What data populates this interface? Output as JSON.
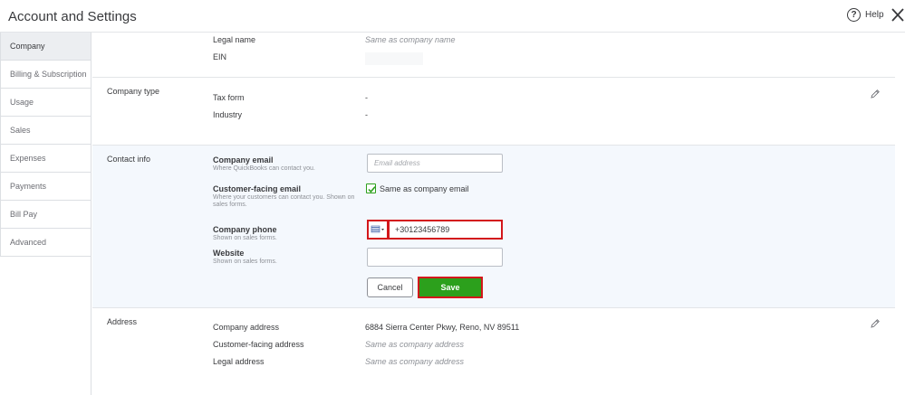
{
  "header": {
    "title": "Account and Settings",
    "help_label": "Help",
    "help_icon_glyph": "?"
  },
  "sidebar": {
    "items": [
      {
        "label": "Company",
        "active": true
      },
      {
        "label": "Billing & Subscription",
        "active": false
      },
      {
        "label": "Usage",
        "active": false
      },
      {
        "label": "Sales",
        "active": false
      },
      {
        "label": "Expenses",
        "active": false
      },
      {
        "label": "Payments",
        "active": false
      },
      {
        "label": "Bill Pay",
        "active": false
      },
      {
        "label": "Advanced",
        "active": false
      }
    ]
  },
  "company_name_section": {
    "legal_name_label": "Legal name",
    "legal_name_value": "Same as company name",
    "ein_label": "EIN"
  },
  "company_type_section": {
    "title": "Company type",
    "tax_form_label": "Tax form",
    "tax_form_value": "-",
    "industry_label": "Industry",
    "industry_value": "-"
  },
  "contact_info_section": {
    "title": "Contact info",
    "company_email_label": "Company email",
    "company_email_sub": "Where QuickBooks can contact you.",
    "company_email_placeholder": "Email address",
    "customer_email_label": "Customer-facing email",
    "customer_email_sub": "Where your customers can contact you. Shown on sales forms.",
    "same_as_company_email_label": "Same as company email",
    "same_as_company_email_checked": true,
    "company_phone_label": "Company phone",
    "company_phone_sub": "Shown on sales forms.",
    "company_phone_value": "+30123456789",
    "website_label": "Website",
    "website_sub": "Shown on sales forms.",
    "website_value": "",
    "cancel_label": "Cancel",
    "save_label": "Save"
  },
  "address_section": {
    "title": "Address",
    "company_address_label": "Company address",
    "company_address_value": "6884 Sierra Center Pkwy, Reno, NV 89511",
    "customer_address_label": "Customer-facing address",
    "customer_address_value": "Same as company address",
    "legal_address_label": "Legal address",
    "legal_address_value": "Same as company address"
  },
  "colors": {
    "accent_green": "#2ca01c",
    "highlight_red": "#d3171b",
    "contact_bg": "#f4f8fd"
  }
}
